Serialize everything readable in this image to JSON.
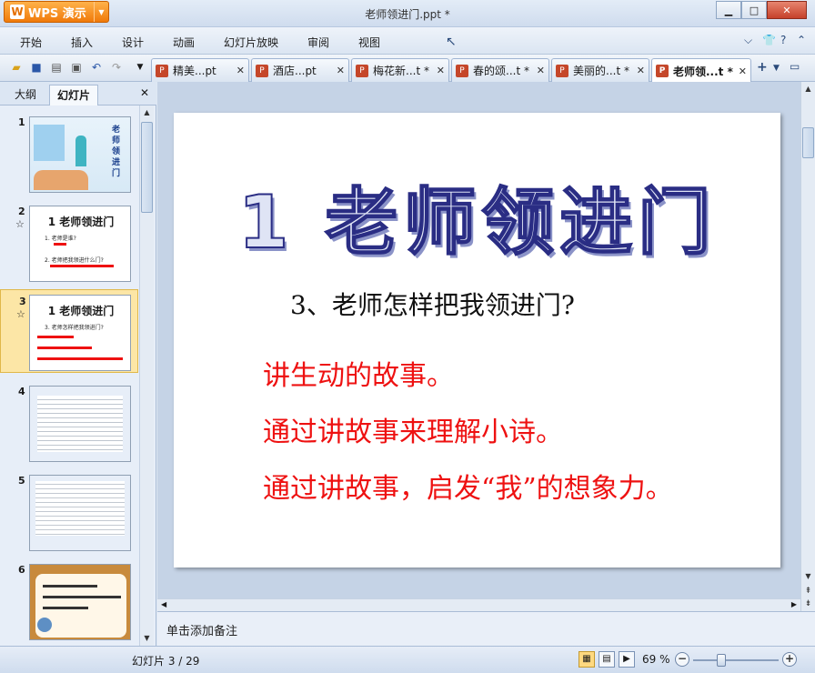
{
  "window": {
    "app_button": "WPS 演示",
    "title": "老师领进门.ppt *"
  },
  "menu": {
    "items": [
      "开始",
      "插入",
      "设计",
      "动画",
      "幻灯片放映",
      "审阅",
      "视图"
    ]
  },
  "doc_tabs": [
    {
      "label": "精美...pt",
      "active": false
    },
    {
      "label": "酒店...pt",
      "active": false
    },
    {
      "label": "梅花新...t *",
      "active": false
    },
    {
      "label": "春的颂...t *",
      "active": false
    },
    {
      "label": "美丽的...t *",
      "active": false
    },
    {
      "label": "老师领...t *",
      "active": true
    }
  ],
  "left_panel": {
    "tab_outline": "大纲",
    "tab_slides": "幻灯片",
    "thumbnails": [
      {
        "num": "1",
        "title": "老师领进门"
      },
      {
        "num": "2",
        "title": "1 老师领进门",
        "line1": "1. 老师是谁?",
        "line2": "2. 老师把我领进什么门?"
      },
      {
        "num": "3",
        "title": "1 老师领进门",
        "line1": "3. 老师怎样把我领进门?"
      },
      {
        "num": "4"
      },
      {
        "num": "5"
      },
      {
        "num": "6"
      }
    ]
  },
  "slide": {
    "title": "1 老师领进门",
    "subtitle": "3、老师怎样把我领进门?",
    "lines": [
      "讲生动的故事。",
      "通过讲故事来理解小诗。",
      "通过讲故事，启发“我”的想象力。"
    ]
  },
  "notes": {
    "placeholder": "单击添加备注"
  },
  "status": {
    "slide_counter": "幻灯片 3 / 29",
    "zoom": "69 %"
  },
  "colors": {
    "accent_orange": "#f07a0a",
    "slide_red_text": "#ee1111",
    "selected_thumb": "#fce6a6"
  }
}
